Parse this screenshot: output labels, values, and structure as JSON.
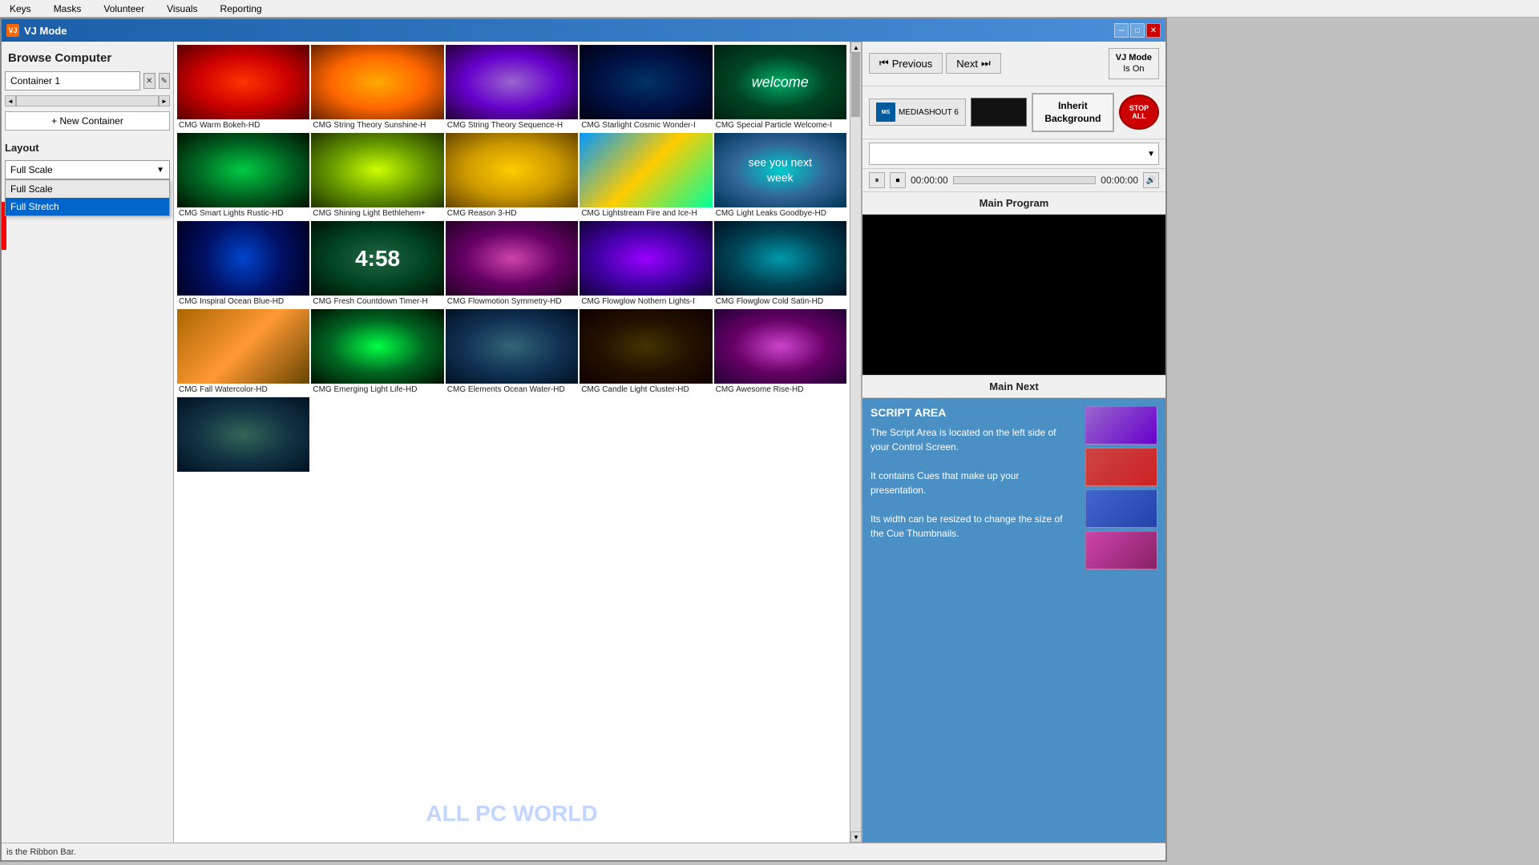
{
  "menu": {
    "items": [
      "Keys",
      "Masks",
      "Volunteer",
      "Visuals",
      "Reporting"
    ]
  },
  "window": {
    "title": "VJ Mode",
    "icon_label": "VJ"
  },
  "left_panel": {
    "browse_computer_label": "Browse Computer",
    "container_value": "Container 1",
    "scrollbar_left": "◄",
    "scrollbar_right": "►",
    "new_container_btn": "+ New Container",
    "layout_label": "Layout",
    "layout_selected": "Full Scale",
    "layout_options": [
      "Full Scale",
      "Full Stretch"
    ]
  },
  "toolbar": {
    "prev_label": "Previous",
    "next_label": "Next",
    "vj_mode_label": "VJ Mode\nIs On",
    "mediashout_label": "MEDIASHOUT 6",
    "inherit_bg_label": "Inherit\nBackground",
    "stop_all_label": "STOP\nALL"
  },
  "transport": {
    "pause_btn": "⏸",
    "stop_btn": "⏹",
    "time_start": "00:00:00",
    "time_end": "00:00:00",
    "volume_btn": "🔊"
  },
  "sections": {
    "main_program": "Main Program",
    "main_next": "Main Next"
  },
  "script_area": {
    "title": "SCRIPT AREA",
    "body": "The Script Area is located on the left side of your Control Screen.\n\nIt contains Cues that make up your presentation.\n\nIts width can be resized to change the size of the Cue Thumbnails."
  },
  "media_items": [
    {
      "label": "CMG Warm Bokeh-HD",
      "thumb_class": "thumb-warm-bokeh"
    },
    {
      "label": "CMG String Theory Sunshine-H",
      "thumb_class": "thumb-string-sunshine"
    },
    {
      "label": "CMG String Theory Sequence-H",
      "thumb_class": "thumb-string-sequence"
    },
    {
      "label": "CMG Starlight Cosmic Wonder-I",
      "thumb_class": "thumb-starlight"
    },
    {
      "label": "CMG Special Particle Welcome-I",
      "thumb_class": "thumb-particle-welcome",
      "overlay": "welcome"
    },
    {
      "label": "CMG Smart Lights Rustic-HD",
      "thumb_class": "thumb-smart-lights"
    },
    {
      "label": "CMG Shining Light Bethlehem+",
      "thumb_class": "thumb-shining-bethlehem"
    },
    {
      "label": "CMG Reason 3-HD",
      "thumb_class": "thumb-reason"
    },
    {
      "label": "CMG Lightstream Fire and Ice-H",
      "thumb_class": "thumb-lightstream"
    },
    {
      "label": "CMG Light Leaks Goodbye-HD",
      "thumb_class": "thumb-light-leaks",
      "overlay": "see-you"
    },
    {
      "label": "CMG Inspiral Ocean Blue-HD",
      "thumb_class": "thumb-inspiral"
    },
    {
      "label": "CMG Fresh Countdown Timer-H",
      "thumb_class": "thumb-countdown",
      "overlay": "countdown",
      "countdown_val": "4:58"
    },
    {
      "label": "CMG Flowmotion Symmetry-HD",
      "thumb_class": "thumb-flowmotion"
    },
    {
      "label": "CMG Flowglow Nothern Lights-I",
      "thumb_class": "thumb-flowglow-northern"
    },
    {
      "label": "CMG Flowglow Cold Satin-HD",
      "thumb_class": "thumb-flowglow-satin"
    },
    {
      "label": "CMG Fall Watercolor-HD",
      "thumb_class": "thumb-watercolor"
    },
    {
      "label": "CMG Emerging Light Life-HD",
      "thumb_class": "thumb-emerging"
    },
    {
      "label": "CMG Elements Ocean Water-HD",
      "thumb_class": "thumb-elements"
    },
    {
      "label": "CMG Candle Light Cluster-HD",
      "thumb_class": "thumb-candle"
    },
    {
      "label": "CMG Awesome Rise-HD",
      "thumb_class": "thumb-awesome"
    },
    {
      "label": "",
      "thumb_class": "thumb-unknown"
    }
  ],
  "status_bar": {
    "text": "is the Ribbon Bar."
  },
  "watermark": "ALL PC WORLD",
  "script_thumbs": [
    {
      "color": "#9966cc"
    },
    {
      "color": "#cc4444"
    },
    {
      "color": "#4466cc"
    },
    {
      "color": "#cc44aa"
    }
  ]
}
